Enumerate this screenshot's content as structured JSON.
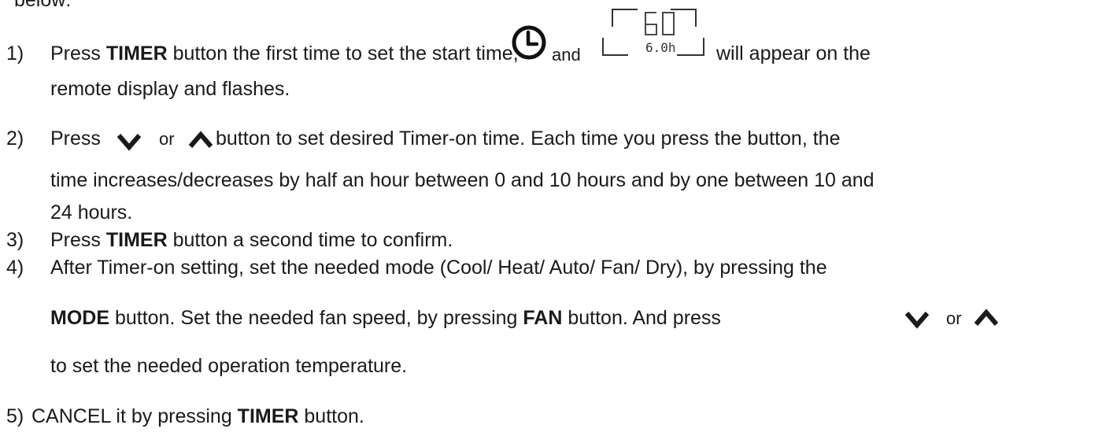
{
  "intro_fragment": "below:",
  "steps": [
    {
      "number": "1)",
      "line1": {
        "a": "Press ",
        "b": "TIMER",
        "c": " button the first time to set the start time,",
        "d": "and",
        "e": "will appear on the"
      },
      "line2": "remote display and flashes.",
      "display_digits": "6.0h",
      "icons": [
        "clock-icon",
        "timer-display-icon"
      ]
    },
    {
      "number": "2)",
      "line1": {
        "a": "Press",
        "or": "or",
        "b": "button to set desired Timer-on time. Each time you press the button, the"
      },
      "line2": "time increases/decreases by half an hour between 0 and 10 hours and by one between 10 and",
      "line3": "24 hours.",
      "icons": [
        "chevron-down-icon",
        "chevron-up-icon"
      ]
    },
    {
      "number": "3)",
      "line1": {
        "a": "Press ",
        "b": "TIMER",
        "c": " button a second time to confirm."
      }
    },
    {
      "number": "4)",
      "line1": "After Timer-on setting, set the needed mode (Cool/ Heat/ Auto/ Fan/ Dry), by pressing the",
      "line2": {
        "a": "MODE",
        "b": " button. Set the needed fan speed, by pressing ",
        "c": "FAN",
        "d": " button. And press",
        "or": "or"
      },
      "line3": "to set the needed operation temperature.",
      "icons": [
        "chevron-down-icon",
        "chevron-up-icon"
      ]
    },
    {
      "number": "5)",
      "line1": {
        "a": "CANCEL it by pressing ",
        "b": "TIMER",
        "c": " button."
      }
    }
  ]
}
